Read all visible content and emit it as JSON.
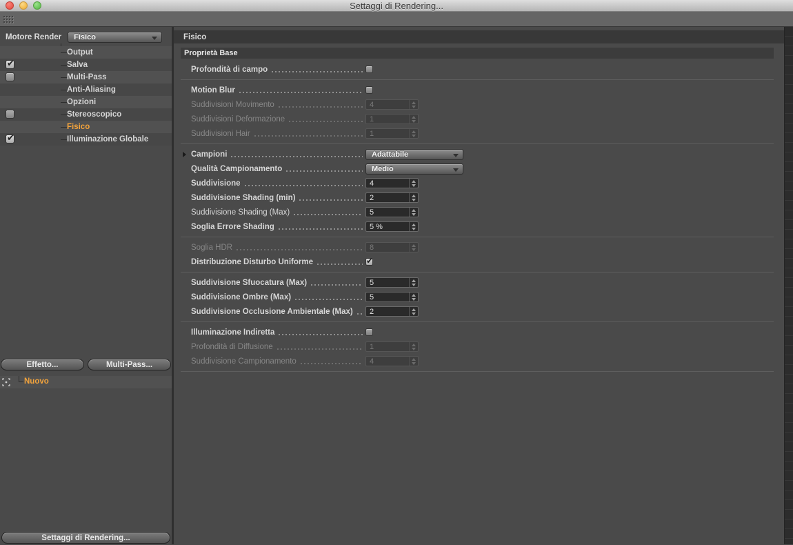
{
  "window": {
    "title": "Settaggi di Rendering..."
  },
  "colors": {
    "accent_orange": "#f2a33c",
    "panel_bg": "#4a4a4a",
    "header_bar": "#383838",
    "field_bg": "#2a2a2a"
  },
  "sidebar": {
    "engine_label": "Motore Render",
    "engine_value": "Fisico",
    "tree": [
      {
        "label": "Output",
        "checkbox": "none",
        "selected": false
      },
      {
        "label": "Salva",
        "checkbox": "checked",
        "selected": false
      },
      {
        "label": "Multi-Pass",
        "checkbox": "unchecked",
        "selected": false
      },
      {
        "label": "Anti-Aliasing",
        "checkbox": "none",
        "selected": false
      },
      {
        "label": "Opzioni",
        "checkbox": "none",
        "selected": false
      },
      {
        "label": "Stereoscopico",
        "checkbox": "unchecked",
        "selected": false
      },
      {
        "label": "Fisico",
        "checkbox": "none",
        "selected": true
      },
      {
        "label": "Illuminazione Globale",
        "checkbox": "checked",
        "selected": false
      }
    ],
    "effect_button": "Effetto...",
    "multipass_button": "Multi-Pass...",
    "effects_list": [
      {
        "label": "Nuovo"
      }
    ],
    "render_settings_button": "Settaggi di Rendering..."
  },
  "main": {
    "header": "Fisico",
    "group_header": "Proprietà Base",
    "rows": [
      {
        "label": "Profondità di campo",
        "type": "checkbox",
        "value": "unchecked",
        "enabled": true
      },
      {
        "label": "Motion Blur",
        "type": "checkbox",
        "value": "unchecked",
        "enabled": true
      },
      {
        "label": "Suddivisioni Movimento",
        "type": "number",
        "value": "4",
        "enabled": false
      },
      {
        "label": "Suddivisioni Deformazione",
        "type": "number",
        "value": "1",
        "enabled": false
      },
      {
        "label": "Suddivisioni Hair",
        "type": "number",
        "value": "1",
        "enabled": false
      },
      {
        "label": "Campioni",
        "type": "dropdown",
        "value": "Adattabile",
        "enabled": true
      },
      {
        "label": "Qualità Campionamento",
        "type": "dropdown",
        "value": "Medio",
        "enabled": true
      },
      {
        "label": "Suddivisione",
        "type": "number",
        "value": "4",
        "enabled": true
      },
      {
        "label": "Suddivisione Shading (min)",
        "type": "number",
        "value": "2",
        "enabled": true
      },
      {
        "label": "Suddivisione Shading (Max)",
        "type": "number",
        "value": "5",
        "enabled": true
      },
      {
        "label": "Soglia Errore Shading",
        "type": "number",
        "value": "5 %",
        "enabled": true
      },
      {
        "label": "Soglia HDR",
        "type": "number",
        "value": "8",
        "enabled": false
      },
      {
        "label": "Distribuzione Disturbo Uniforme",
        "type": "checkbox",
        "value": "checked",
        "enabled": true
      },
      {
        "label": "Suddivisione Sfuocatura (Max)",
        "type": "number",
        "value": "5",
        "enabled": true
      },
      {
        "label": "Suddivisione Ombre (Max)",
        "type": "number",
        "value": "5",
        "enabled": true
      },
      {
        "label": "Suddivisione Occlusione Ambientale (Max)",
        "type": "number",
        "value": "2",
        "enabled": true
      },
      {
        "label": "Illuminazione Indiretta",
        "type": "checkbox",
        "value": "unchecked",
        "enabled": true
      },
      {
        "label": "Profondità di Diffusione",
        "type": "number",
        "value": "1",
        "enabled": false
      },
      {
        "label": "Suddivisione Campionamento",
        "type": "number",
        "value": "4",
        "enabled": false
      }
    ]
  }
}
